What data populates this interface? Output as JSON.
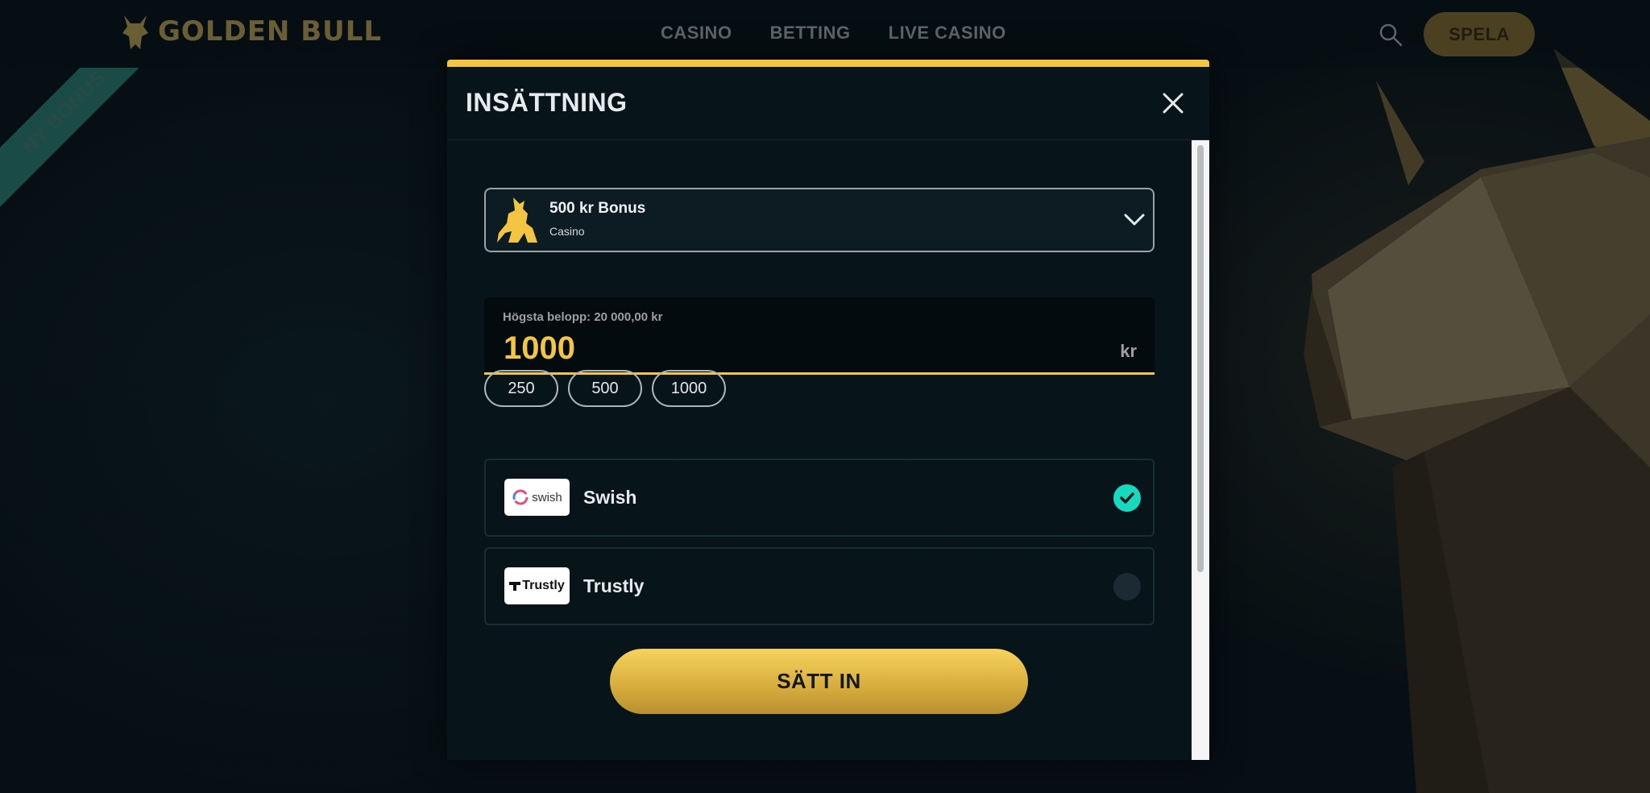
{
  "header": {
    "logo_text": "GOLDEN BULL",
    "nav": [
      "CASINO",
      "BETTING",
      "LIVE CASINO"
    ],
    "play_label": "SPELA"
  },
  "ribbon": {
    "label": "NY BONUS"
  },
  "modal": {
    "title": "INSÄTTNING",
    "bonus": {
      "title": "500 kr Bonus",
      "subtitle": "Casino"
    },
    "amount": {
      "label": "Högsta belopp: 20 000,00 kr",
      "value": "1000",
      "unit": "kr",
      "quick": [
        "250",
        "500",
        "1000"
      ]
    },
    "payment_methods": [
      {
        "name": "Swish",
        "logo_text": "swish",
        "selected": true
      },
      {
        "name": "Trustly",
        "logo_text": "Trustly",
        "selected": false
      }
    ],
    "submit_label": "SÄTT IN"
  },
  "colors": {
    "accent": "#f4c542",
    "selected": "#16d9c0",
    "modal_bg": "#071419"
  }
}
